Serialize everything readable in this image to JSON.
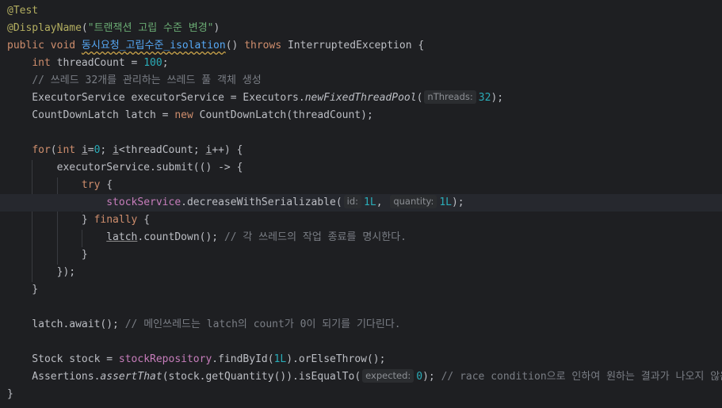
{
  "editor": {
    "language": "java",
    "colors": {
      "background": "#1e1f22",
      "current_line": "#26282e",
      "default_text": "#bcbec4",
      "keyword": "#cf8e6d",
      "annotation": "#b3ae60",
      "string": "#6aab73",
      "number": "#2aacb8",
      "method_declaration": "#56a8f5",
      "field": "#c77dbb",
      "comment": "#7a7e85",
      "inlay_hint": "#8c8f94"
    },
    "lines": [
      {
        "tokens": [
          {
            "t": "@Test",
            "c": "annotation"
          }
        ]
      },
      {
        "tokens": [
          {
            "t": "@DisplayName",
            "c": "annotation"
          },
          {
            "t": "(",
            "c": "plain"
          },
          {
            "t": "\"트랜잭션 고립 수준 변경\"",
            "c": "string"
          },
          {
            "t": ")",
            "c": "plain"
          }
        ]
      },
      {
        "tokens": [
          {
            "t": "public void ",
            "c": "keyword"
          },
          {
            "t": "동시요청_고립수준_isolation",
            "c": "method-decl squiggle"
          },
          {
            "t": "() ",
            "c": "plain"
          },
          {
            "t": "throws ",
            "c": "keyword"
          },
          {
            "t": "InterruptedException {",
            "c": "plain"
          }
        ]
      },
      {
        "tokens": [
          {
            "t": "    ",
            "c": "plain"
          },
          {
            "t": "int ",
            "c": "keyword"
          },
          {
            "t": "threadCount = ",
            "c": "plain"
          },
          {
            "t": "100",
            "c": "number"
          },
          {
            "t": ";",
            "c": "plain"
          }
        ]
      },
      {
        "tokens": [
          {
            "t": "    ",
            "c": "plain"
          },
          {
            "t": "// 쓰레드 32개를 관리하는 쓰레드 풀 객체 생성",
            "c": "comment"
          }
        ]
      },
      {
        "tokens": [
          {
            "t": "    ExecutorService executorService = Executors.",
            "c": "plain"
          },
          {
            "t": "newFixedThreadPool",
            "c": "plain italic"
          },
          {
            "t": "(",
            "c": "plain"
          },
          {
            "hint": "nThreads:"
          },
          {
            "t": "32",
            "c": "number"
          },
          {
            "t": ");",
            "c": "plain"
          }
        ]
      },
      {
        "tokens": [
          {
            "t": "    CountDownLatch latch = ",
            "c": "plain"
          },
          {
            "t": "new ",
            "c": "keyword"
          },
          {
            "t": "CountDownLatch(threadCount);",
            "c": "plain"
          }
        ]
      },
      {
        "tokens": []
      },
      {
        "tokens": [
          {
            "t": "    ",
            "c": "plain"
          },
          {
            "t": "for",
            "c": "keyword"
          },
          {
            "t": "(",
            "c": "plain"
          },
          {
            "t": "int ",
            "c": "keyword"
          },
          {
            "t": "i",
            "c": "plain underline"
          },
          {
            "t": "=",
            "c": "plain"
          },
          {
            "t": "0",
            "c": "number"
          },
          {
            "t": "; ",
            "c": "plain"
          },
          {
            "t": "i",
            "c": "plain underline"
          },
          {
            "t": "<threadCount; ",
            "c": "plain"
          },
          {
            "t": "i",
            "c": "plain underline"
          },
          {
            "t": "++) {",
            "c": "plain"
          }
        ]
      },
      {
        "tokens": [
          {
            "t": "        executorService.submit(() -> {",
            "c": "plain"
          }
        ]
      },
      {
        "tokens": [
          {
            "t": "            ",
            "c": "plain"
          },
          {
            "t": "try ",
            "c": "keyword"
          },
          {
            "t": "{",
            "c": "plain"
          }
        ]
      },
      {
        "current": true,
        "tokens": [
          {
            "t": "                ",
            "c": "plain"
          },
          {
            "t": "stockService",
            "c": "field"
          },
          {
            "t": ".decreaseWithSerializable(",
            "c": "plain"
          },
          {
            "hint": "id:"
          },
          {
            "t": "1L",
            "c": "number"
          },
          {
            "t": ", ",
            "c": "plain"
          },
          {
            "hint": "quantity:"
          },
          {
            "t": "1L",
            "c": "number"
          },
          {
            "t": ");",
            "c": "plain"
          }
        ]
      },
      {
        "tokens": [
          {
            "t": "            } ",
            "c": "plain"
          },
          {
            "t": "finally ",
            "c": "keyword"
          },
          {
            "t": "{",
            "c": "plain"
          }
        ]
      },
      {
        "tokens": [
          {
            "t": "                ",
            "c": "plain"
          },
          {
            "t": "latch",
            "c": "plain underline"
          },
          {
            "t": ".countDown(); ",
            "c": "plain"
          },
          {
            "t": "// 각 쓰레드의 작업 종료를 명시한다.",
            "c": "comment"
          }
        ]
      },
      {
        "tokens": [
          {
            "t": "            }",
            "c": "plain"
          }
        ]
      },
      {
        "tokens": [
          {
            "t": "        });",
            "c": "plain"
          }
        ]
      },
      {
        "tokens": [
          {
            "t": "    }",
            "c": "plain"
          }
        ]
      },
      {
        "tokens": []
      },
      {
        "tokens": [
          {
            "t": "    latch.await(); ",
            "c": "plain"
          },
          {
            "t": "// 메인쓰레드는 latch의 count가 0이 되기를 기다린다.",
            "c": "comment"
          }
        ]
      },
      {
        "tokens": []
      },
      {
        "tokens": [
          {
            "t": "    Stock stock = ",
            "c": "plain"
          },
          {
            "t": "stockRepository",
            "c": "field"
          },
          {
            "t": ".findById(",
            "c": "plain"
          },
          {
            "t": "1L",
            "c": "number"
          },
          {
            "t": ").orElseThrow();",
            "c": "plain"
          }
        ]
      },
      {
        "tokens": [
          {
            "t": "    Assertions.",
            "c": "plain"
          },
          {
            "t": "assertThat",
            "c": "plain italic"
          },
          {
            "t": "(stock.getQuantity()).isEqualTo(",
            "c": "plain"
          },
          {
            "hint": "expected:"
          },
          {
            "t": "0",
            "c": "number"
          },
          {
            "t": "); ",
            "c": "plain"
          },
          {
            "t": "// race condition으로 인하여 원하는 결과가 나오지 않음",
            "c": "comment"
          }
        ]
      },
      {
        "tokens": [
          {
            "t": "}",
            "c": "plain"
          }
        ]
      }
    ]
  }
}
